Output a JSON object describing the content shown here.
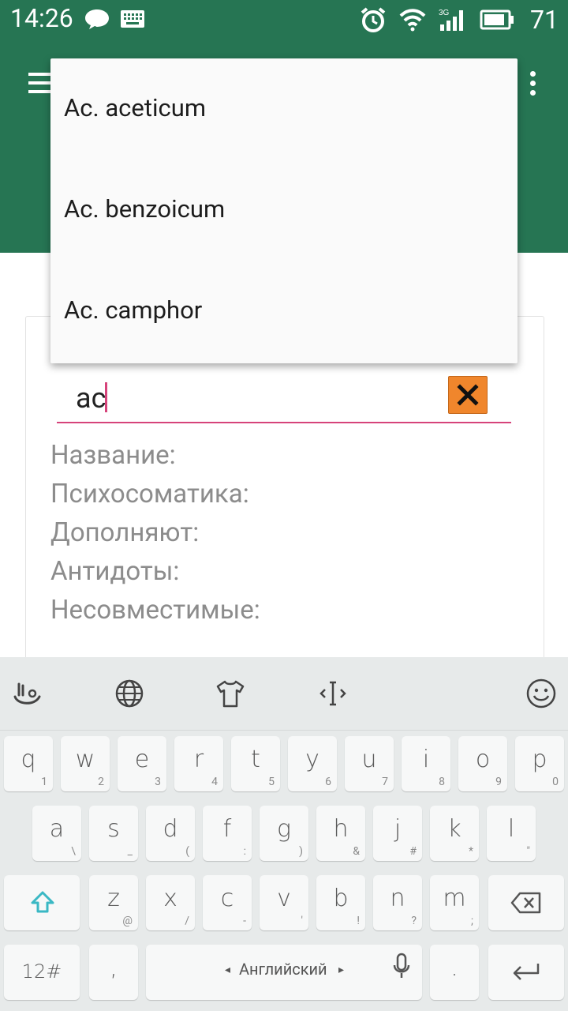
{
  "status_bar": {
    "time": "14:26",
    "battery": "71",
    "network": "3G"
  },
  "toolbar": {
    "menu_icon": "hamburger-icon",
    "overflow_icon": "overflow-menu-icon"
  },
  "autocomplete": {
    "items": [
      {
        "label": "Ac. aceticum"
      },
      {
        "label": "Ac. benzoicum"
      },
      {
        "label": "Ac. camphor"
      }
    ]
  },
  "search": {
    "value": "ac",
    "clear_icon": "close-icon"
  },
  "fields": [
    {
      "label": "Название:"
    },
    {
      "label": "Психосоматика:"
    },
    {
      "label": "Дополняют:"
    },
    {
      "label": "Антидоты:"
    },
    {
      "label": "Несовместимые:"
    }
  ],
  "keyboard": {
    "row1": [
      {
        "k": "q",
        "s": "1"
      },
      {
        "k": "w",
        "s": "2"
      },
      {
        "k": "e",
        "s": "3"
      },
      {
        "k": "r",
        "s": "4"
      },
      {
        "k": "t",
        "s": "5"
      },
      {
        "k": "y",
        "s": "6"
      },
      {
        "k": "u",
        "s": "7"
      },
      {
        "k": "i",
        "s": "8"
      },
      {
        "k": "o",
        "s": "9"
      },
      {
        "k": "p",
        "s": "0"
      }
    ],
    "row2": [
      {
        "k": "a",
        "s": "\\"
      },
      {
        "k": "s",
        "s": "_"
      },
      {
        "k": "d",
        "s": "("
      },
      {
        "k": "f",
        "s": ":"
      },
      {
        "k": "g",
        "s": ")"
      },
      {
        "k": "h",
        "s": "&"
      },
      {
        "k": "j",
        "s": "#"
      },
      {
        "k": "k",
        "s": "*"
      },
      {
        "k": "l",
        "s": "\""
      }
    ],
    "row3": [
      {
        "k": "z",
        "s": "@"
      },
      {
        "k": "x",
        "s": "/"
      },
      {
        "k": "c",
        "s": "-"
      },
      {
        "k": "v",
        "s": "'"
      },
      {
        "k": "b",
        "s": "!"
      },
      {
        "k": "n",
        "s": "?"
      },
      {
        "k": "m",
        "s": ";"
      }
    ],
    "symbols_label": "12#",
    "comma_label": ",",
    "period_label": ".",
    "space_label": "Английский",
    "accent_color": "#3ab8c4"
  }
}
